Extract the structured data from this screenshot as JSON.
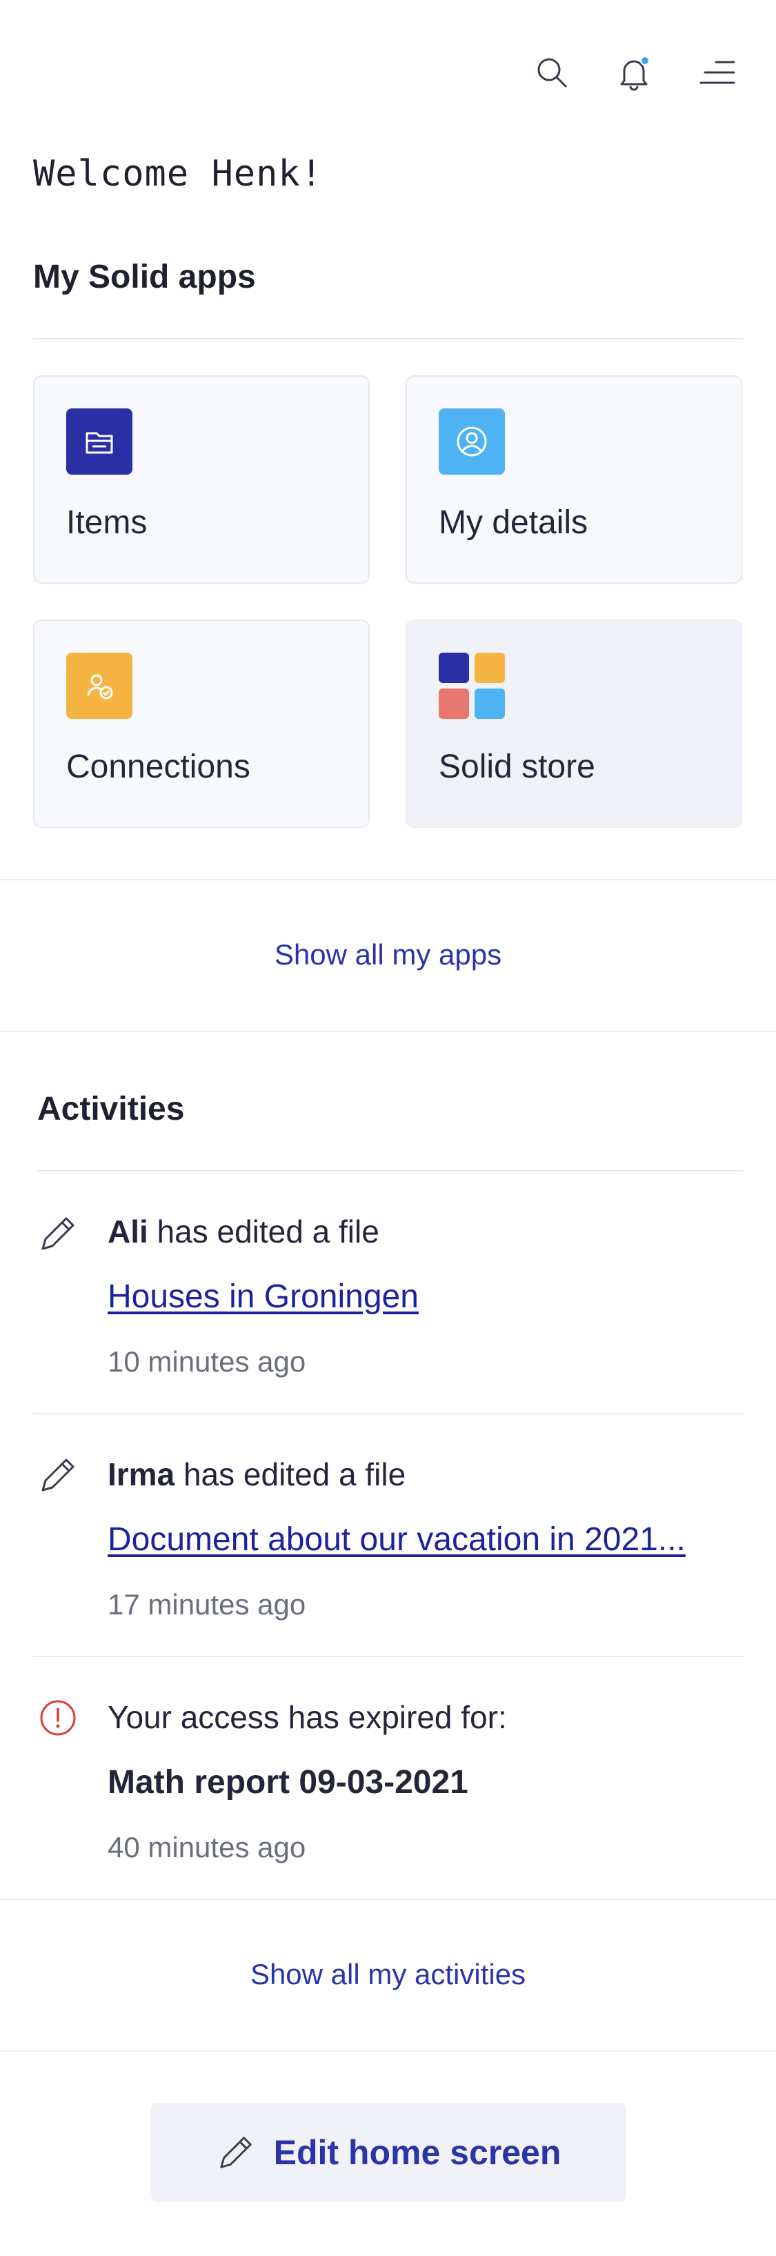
{
  "header": {
    "search_icon": "search-icon",
    "bell_icon": "bell-icon",
    "menu_icon": "menu-icon",
    "notification_dot_color": "#3ea8e6"
  },
  "welcome": "Welcome Henk!",
  "apps": {
    "title": "My Solid apps",
    "items": [
      {
        "label": "Items",
        "icon": "folder-icon",
        "color": "#2b2fa5"
      },
      {
        "label": "My details",
        "icon": "user-circle-icon",
        "color": "#4fb2f2"
      },
      {
        "label": "Connections",
        "icon": "user-check-icon",
        "color": "#f5b342"
      },
      {
        "label": "Solid store",
        "icon": "store-grid-icon",
        "colors": [
          "#2b2fa5",
          "#f5b342",
          "#e8776f",
          "#4fb2f2"
        ]
      }
    ],
    "show_all": "Show all my apps"
  },
  "activities": {
    "title": "Activities",
    "items": [
      {
        "icon": "pencil-icon",
        "actor": "Ali",
        "action": " has edited a file",
        "target": "Houses in Groningen",
        "time": "10 minutes ago"
      },
      {
        "icon": "pencil-icon",
        "actor": "Irma",
        "action": " has edited a file",
        "target": "Document about our vacation in 2021...",
        "time": "17 minutes ago"
      },
      {
        "icon": "alert-circle-icon",
        "message": "Your access has expired for:",
        "target": "Math report 09-03-2021",
        "time": "40 minutes ago"
      }
    ],
    "show_all": "Show all my activities"
  },
  "footer": {
    "edit_label": "Edit home screen",
    "edit_icon": "pencil-icon"
  }
}
